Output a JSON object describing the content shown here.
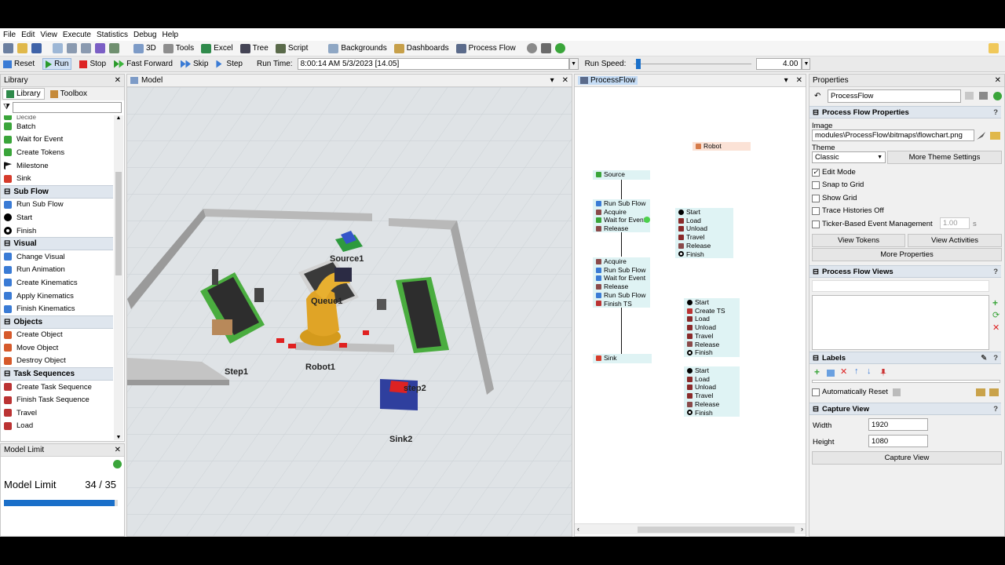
{
  "menu": [
    "File",
    "Edit",
    "View",
    "Execute",
    "Statistics",
    "Debug",
    "Help"
  ],
  "toolbar": {
    "btn_3d": "3D",
    "btn_tools": "Tools",
    "btn_excel": "Excel",
    "btn_tree": "Tree",
    "btn_script": "Script",
    "btn_backgrounds": "Backgrounds",
    "btn_dashboards": "Dashboards",
    "btn_processflow": "Process Flow"
  },
  "runbar": {
    "reset": "Reset",
    "run": "Run",
    "stop": "Stop",
    "fastforward": "Fast Forward",
    "skip": "Skip",
    "step": "Step",
    "runtime_label": "Run Time:",
    "runtime_value": "8:00:14 AM  5/3/2023  [14.05]",
    "speed_label": "Run Speed:",
    "speed_value": "4.00",
    "speed_fraction": 0.02
  },
  "library": {
    "title": "Library",
    "tab_library": "Library",
    "tab_toolbox": "Toolbox",
    "search_placeholder": "",
    "partial_item": "Decide",
    "items_a": [
      "Batch",
      "Wait for Event",
      "Create Tokens",
      "Milestone",
      "Sink"
    ],
    "head_subflow": "Sub Flow",
    "items_b": [
      "Run Sub Flow",
      "Start",
      "Finish"
    ],
    "head_visual": "Visual",
    "items_c": [
      "Change Visual",
      "Run Animation",
      "Create Kinematics",
      "Apply Kinematics",
      "Finish Kinematics"
    ],
    "head_objects": "Objects",
    "items_d": [
      "Create Object",
      "Move Object",
      "Destroy Object"
    ],
    "head_tasks": "Task Sequences",
    "items_e": [
      "Create Task Sequence",
      "Finish Task Sequence",
      "Travel",
      "Load"
    ]
  },
  "modellimit": {
    "title": "Model Limit",
    "label": "Model Limit",
    "value": "34 / 35",
    "fraction": 0.97
  },
  "model": {
    "tab": "Model",
    "labels": {
      "source1": "Source1",
      "queue1": "Queue1",
      "robot1": "Robot1",
      "step1": "Step1",
      "step2": "step2",
      "sink2": "Sink2"
    }
  },
  "processflow": {
    "tab": "ProcessFlow",
    "robot": "Robot",
    "source": "Source",
    "box1": [
      "Run Sub Flow",
      "Acquire",
      "Wait for Event",
      "Release"
    ],
    "box2": [
      "Acquire",
      "Run Sub Flow",
      "Wait for Event",
      "Release",
      "Run Sub Flow",
      "Finish TS"
    ],
    "sink": "Sink",
    "sub1": [
      "Start",
      "Load",
      "Unload",
      "Travel",
      "Release",
      "Finish"
    ],
    "sub2": [
      "Start",
      "Create TS",
      "Load",
      "Unload",
      "Travel",
      "Release",
      "Finish"
    ],
    "sub3": [
      "Start",
      "Load",
      "Unload",
      "Travel",
      "Release",
      "Finish"
    ]
  },
  "properties": {
    "title": "Properties",
    "name": "ProcessFlow",
    "sec_pf": "Process Flow Properties",
    "image_label": "Image",
    "image_value": "modules\\ProcessFlow\\bitmaps\\flowchart.png",
    "theme_label": "Theme",
    "theme_value": "Classic",
    "more_theme": "More Theme Settings",
    "cb_edit": "Edit Mode",
    "cb_snap": "Snap to Grid",
    "cb_grid": "Show Grid",
    "cb_trace": "Trace Histories Off",
    "cb_ticker": "Ticker-Based Event Management",
    "ticker_value": "1.00",
    "ticker_unit": "s",
    "view_tokens": "View Tokens",
    "view_activities": "View Activities",
    "more_props": "More Properties",
    "sec_views": "Process Flow Views",
    "sec_labels": "Labels",
    "auto_reset": "Automatically Reset",
    "sec_capture": "Capture View",
    "width_label": "Width",
    "width_value": "1920",
    "height_label": "Height",
    "height_value": "1080",
    "capture_btn": "Capture View",
    "help": "?"
  },
  "colors": {
    "accent": "#1a6fc9",
    "pf_box": "#dff3f4",
    "section": "#dfe6ee",
    "tab_active": "#c5dcf5"
  }
}
